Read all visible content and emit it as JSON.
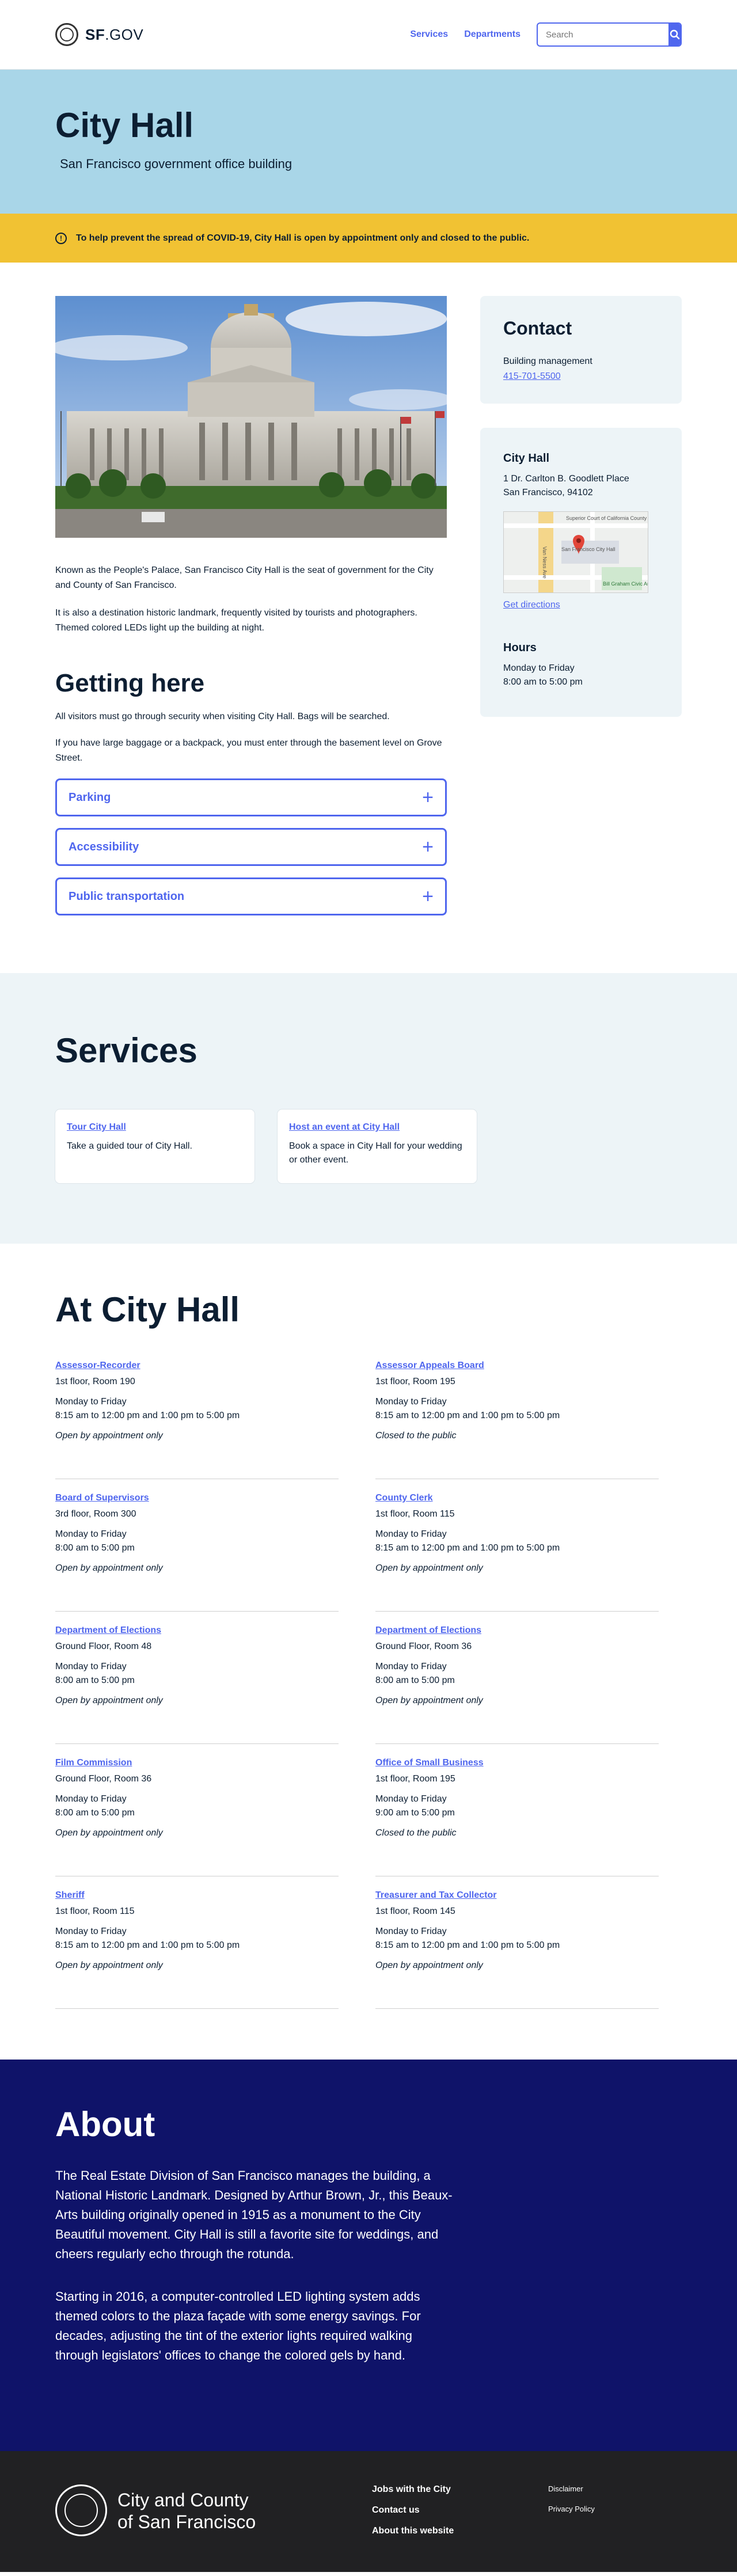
{
  "header": {
    "logo_text": "SF",
    "logo_suffix": ".GOV",
    "nav": [
      "Services",
      "Departments"
    ],
    "search_placeholder": "Search"
  },
  "hero": {
    "title": "City Hall",
    "subtitle": "San Francisco government office building"
  },
  "alert": {
    "text": "To help prevent the spread of COVID-19, City Hall is open by appointment only and closed to the public."
  },
  "description": [
    "Known as the People's Palace, San Francisco City Hall is the seat of government for the City and County of San Francisco.",
    "It is also a destination historic landmark, frequently visited by tourists and photographers. Themed colored LEDs light up the building at night."
  ],
  "getting_here": {
    "title": "Getting here",
    "paragraphs": [
      "All visitors must go through security when visiting City Hall. Bags will be searched.",
      "If you have large baggage or a backpack, you must enter through the basement level on Grove Street."
    ],
    "accordion": [
      "Parking",
      "Accessibility",
      "Public transportation"
    ]
  },
  "contact": {
    "title": "Contact",
    "label": "Building management",
    "phone": "415-701-5500"
  },
  "location": {
    "name": "City Hall",
    "address_line1": "1 Dr. Carlton B. Goodlett Place",
    "address_line2": "San Francisco, 94102",
    "map_labels": [
      "Superior Court of California County of...",
      "San Francisco City Hall",
      "Van Ness Ave",
      "Bill Graham Civic Auditorium"
    ],
    "directions": "Get directions",
    "hours_title": "Hours",
    "hours_days": "Monday to Friday",
    "hours_time": "8:00 am to 5:00 pm"
  },
  "services": {
    "title": "Services",
    "cards": [
      {
        "title": "Tour City Hall",
        "desc": "Take a guided tour of City Hall."
      },
      {
        "title": "Host an event at City Hall",
        "desc": "Book a space in City Hall for your wedding or other event."
      }
    ]
  },
  "at_city_hall": {
    "title": "At City Hall",
    "offices": [
      {
        "name": "Assessor-Recorder",
        "room": "1st floor, Room 190",
        "days": "Monday to Friday",
        "hours": "8:15 am to 12:00 pm and 1:00 pm to 5:00 pm",
        "status": "Open by appointment only"
      },
      {
        "name": "Assessor Appeals Board",
        "room": "1st floor, Room 195",
        "days": "Monday to Friday",
        "hours": "8:15 am to 12:00 pm and 1:00 pm to 5:00 pm",
        "status": "Closed to the public"
      },
      {
        "name": "Board of Supervisors",
        "room": "3rd floor, Room 300",
        "days": "Monday to Friday",
        "hours": "8:00 am to 5:00 pm",
        "status": "Open by appointment only"
      },
      {
        "name": "County Clerk",
        "room": "1st floor, Room 115",
        "days": "Monday to Friday",
        "hours": "8:15 am to 12:00 pm and 1:00 pm to 5:00 pm",
        "status": "Open by appointment only"
      },
      {
        "name": "Department of Elections",
        "room": "Ground Floor, Room 48",
        "days": "Monday to Friday",
        "hours": "8:00 am to 5:00 pm",
        "status": "Open by appointment only"
      },
      {
        "name": "Department of Elections",
        "room": "Ground Floor, Room 36",
        "days": "Monday to Friday",
        "hours": "8:00 am to 5:00 pm",
        "status": "Open by appointment only"
      },
      {
        "name": "Film Commission",
        "room": "Ground Floor, Room 36",
        "days": "Monday to Friday",
        "hours": "8:00 am to 5:00 pm",
        "status": "Open by appointment only"
      },
      {
        "name": "Office of Small Business",
        "room": "1st floor, Room 195",
        "days": "Monday to Friday",
        "hours": "9:00 am to 5:00 pm",
        "status": "Closed to the public"
      },
      {
        "name": "Sheriff",
        "room": "1st floor, Room 115",
        "days": "Monday to Friday",
        "hours": "8:15 am to 12:00 pm and 1:00 pm to 5:00 pm",
        "status": "Open by appointment only"
      },
      {
        "name": "Treasurer and Tax Collector",
        "room": "1st floor, Room 145",
        "days": "Monday to Friday",
        "hours": "8:15 am to 12:00 pm and 1:00 pm to 5:00 pm",
        "status": "Open by appointment only"
      }
    ]
  },
  "about": {
    "title": "About",
    "paragraphs": [
      "The Real Estate Division of San Francisco manages the building, a National Historic Landmark. Designed by Arthur Brown, Jr., this Beaux-Arts building originally opened in 1915 as a monument to the City Beautiful movement. City Hall is still a favorite site for weddings, and cheers regularly echo through the rotunda.",
      "Starting in 2016, a computer-controlled LED lighting system adds themed colors to the plaza façade with some energy savings. For decades, adjusting the tint of the exterior lights required walking through legislators' offices to change the colored gels by hand."
    ]
  },
  "footer": {
    "name_line1": "City and County",
    "name_line2": "of San Francisco",
    "links": [
      "Jobs with the City",
      "Contact us",
      "About this website"
    ],
    "legal": [
      "Disclaimer",
      "Privacy Policy"
    ]
  },
  "colors": {
    "accent": "#4f66ee",
    "hero_bg": "#a9d6e8",
    "alert_bg": "#f1c233",
    "about_bg": "#0f1369",
    "footer_bg": "#212123"
  }
}
